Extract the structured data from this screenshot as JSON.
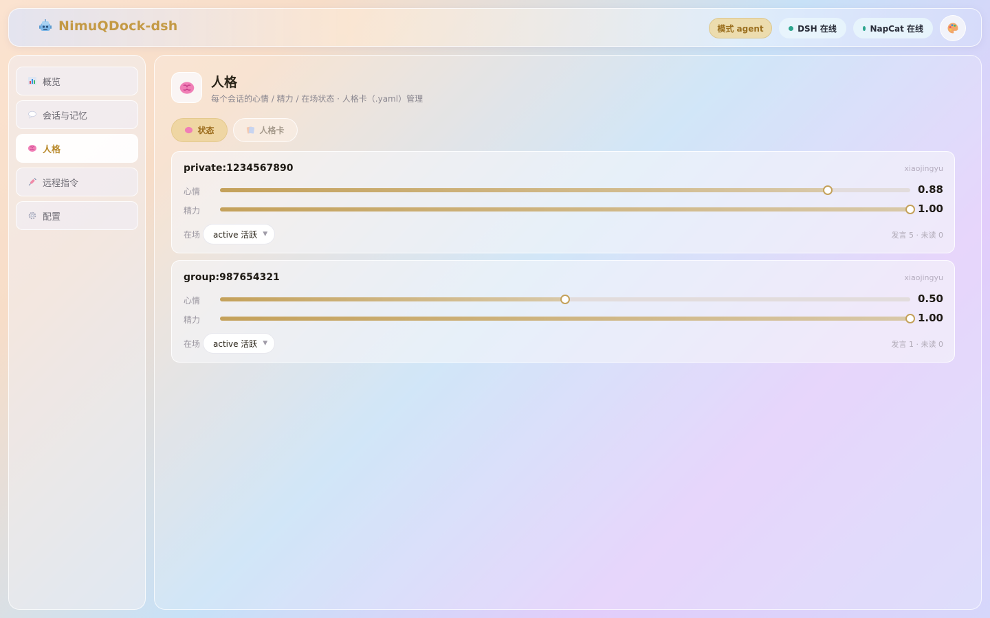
{
  "header": {
    "brand_name": "NimuQDock-dsh",
    "mode_label": "模式 agent",
    "dsh_status": "DSH 在线",
    "napcat_status": "NapCat 在线",
    "status_color": "#2ca58d",
    "brand_color": "#c49a45"
  },
  "sidebar": {
    "items": [
      {
        "label": "概览",
        "icon": "bar-chart-icon",
        "active": false
      },
      {
        "label": "会话与记忆",
        "icon": "speech-bubble-icon",
        "active": false
      },
      {
        "label": "人格",
        "icon": "brain-icon",
        "active": true
      },
      {
        "label": "远程指令",
        "icon": "syringe-icon",
        "active": false
      },
      {
        "label": "配置",
        "icon": "gear-icon",
        "active": false
      }
    ]
  },
  "page": {
    "title": "人格",
    "subtitle": "每个会话的心情 / 精力 / 在场状态 · 人格卡（.yaml）管理",
    "icon": "brain-icon",
    "tabs": [
      {
        "label": "状态",
        "icon": "brain-icon",
        "active": true
      },
      {
        "label": "人格卡",
        "icon": "cards-icon",
        "active": false
      }
    ]
  },
  "sessions": [
    {
      "id": "private:1234567890",
      "persona": "xiaojingyu",
      "mood_label": "心情",
      "mood": 0.88,
      "mood_text": "0.88",
      "energy_label": "精力",
      "energy": 1.0,
      "energy_text": "1.00",
      "presence_label": "在场",
      "presence": "active 活跃",
      "stats": "发言 5 · 未读 0"
    },
    {
      "id": "group:987654321",
      "persona": "xiaojingyu",
      "mood_label": "心情",
      "mood": 0.5,
      "mood_text": "0.50",
      "energy_label": "精力",
      "energy": 1.0,
      "energy_text": "1.00",
      "presence_label": "在场",
      "presence": "active 活跃",
      "stats": "发言 1 · 未读 0"
    }
  ],
  "accent_color": "#c4a15a"
}
